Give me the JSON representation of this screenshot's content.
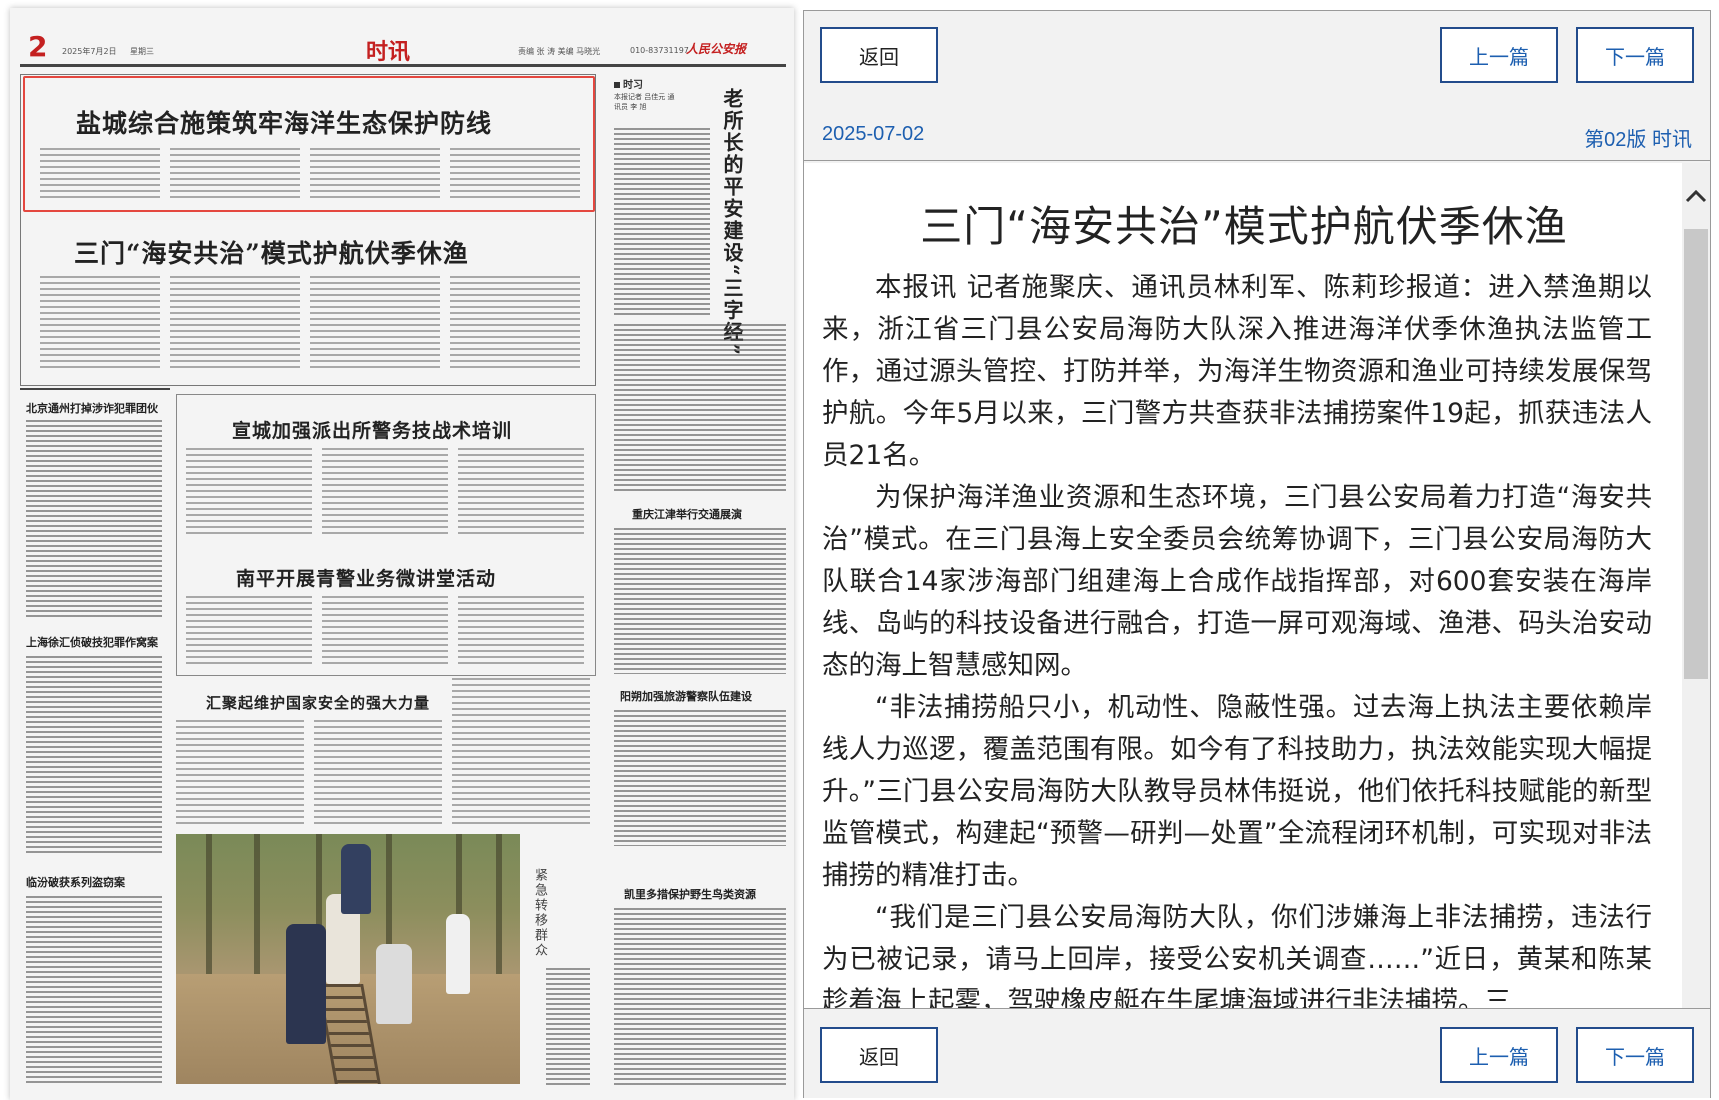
{
  "paper": {
    "page_number": "2",
    "date": "2025年7月2日",
    "weekday": "星期三",
    "section": "时讯",
    "editors": "责编 张 涛  美编 马晓光",
    "phone": "010-83731197",
    "masthead_logo": "人民公安报",
    "headlines": {
      "lead": "盐城综合施策筑牢海洋生态保护防线",
      "second": "三门“海安共治”模式护航伏季休渔",
      "third": "宣城加强派出所警务技战术培训",
      "fourth": "南平开展青警业务微讲堂活动",
      "fifth": "汇聚起维护国家安全的强大力量"
    },
    "side_column_label": "时习",
    "side_title": "老所长的平安建设“三字经”",
    "side_byline": "本报记者 吕佳元 通讯员 李 旭",
    "left_briefs": [
      "北京通州打掉涉诈犯罪团伙",
      "上海徐汇侦破技犯罪作窝案",
      "临汾破获系列盗窃案"
    ],
    "right_briefs": [
      "重庆江津举行交通展演",
      "阳朔加强旅游警察队伍建设",
      "凯里多措保护野生鸟类资源"
    ],
    "photo_caption": "紧急转移群众"
  },
  "reader": {
    "back_label": "返回",
    "prev_label": "上一篇",
    "next_label": "下一篇",
    "date": "2025-07-02",
    "edition": "第02版 时讯",
    "article": {
      "title": "三门“海安共治”模式护航伏季休渔",
      "paragraphs": [
        "本报讯 记者施聚庆、通讯员林利军、陈莉珍报道：进入禁渔期以来，浙江省三门县公安局海防大队深入推进海洋伏季休渔执法监管工作，通过源头管控、打防并举，为海洋生物资源和渔业可持续发展保驾护航。今年5月以来，三门警方共查获非法捕捞案件19起，抓获违法人员21名。",
        "为保护海洋渔业资源和生态环境，三门县公安局着力打造“海安共治”模式。在三门县海上安全委员会统筹协调下，三门县公安局海防大队联合14家涉海部门组建海上合成作战指挥部，对600套安装在海岸线、岛屿的科技设备进行融合，打造一屏可观海域、渔港、码头治安动态的海上智慧感知网。",
        "“非法捕捞船只小，机动性、隐蔽性强。过去海上执法主要依赖岸线人力巡逻，覆盖范围有限。如今有了科技助力，执法效能实现大幅提升。”三门县公安局海防大队教导员林伟挺说，他们依托科技赋能的新型监管模式，构建起“预警—研判—处置”全流程闭环机制，可实现对非法捕捞的精准打击。",
        "“我们是三门县公安局海防大队，你们涉嫌海上非法捕捞，违法行为已被记录，请马上回岸，接受公安机关调查……”近日，黄某和陈某趁着海上起雾，驾驶橡皮艇在牛尾塘海域进行非法捕捞。三"
      ]
    }
  },
  "colors": {
    "accent_blue": "#1d5fb0",
    "button_border": "#234c8c",
    "highlight_red": "#e4473f",
    "masthead_red": "#c42020"
  }
}
